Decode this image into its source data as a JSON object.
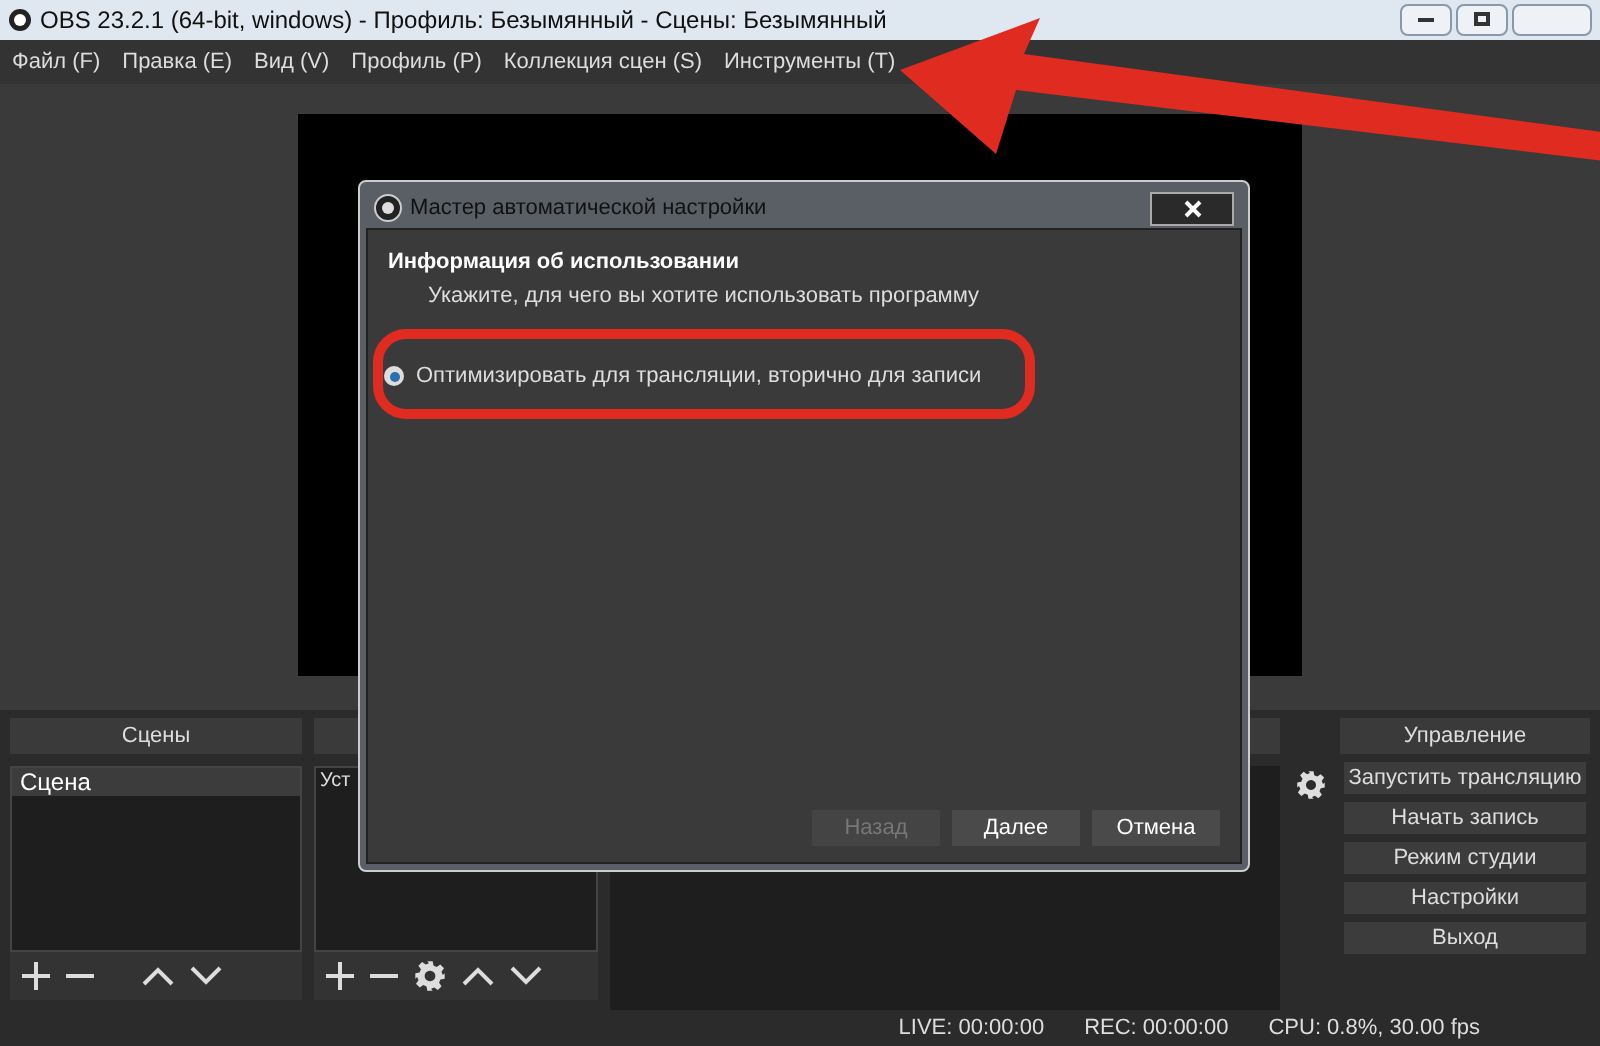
{
  "window": {
    "title": "OBS 23.2.1 (64-bit, windows) - Профиль: Безымянный - Сцены: Безымянный"
  },
  "menu": [
    "Файл (F)",
    "Правка (E)",
    "Вид (V)",
    "Профиль (P)",
    "Коллекция сцен (S)",
    "Инструменты (T)"
  ],
  "scenes_dock": {
    "title": "Сцены",
    "items": [
      {
        "label": "Сцена",
        "selected": true
      }
    ]
  },
  "sources_dock": {
    "items": [
      {
        "label": "Уст",
        "selected": false
      }
    ]
  },
  "controls_dock": {
    "title": "Управление",
    "buttons": [
      "Запустить трансляцию",
      "Начать запись",
      "Режим студии",
      "Настройки",
      "Выход"
    ]
  },
  "status_bar": {
    "live": "LIVE: 00:00:00",
    "rec": "REC: 00:00:00",
    "cpu": "CPU: 0.8%, 30.00 fps"
  },
  "dialog": {
    "title": "Мастер автоматической настройки",
    "heading": "Информация об использовании",
    "subheading": "Укажите, для чего вы хотите использовать программу",
    "options": [
      {
        "label": "Оптимизировать для трансляции, вторично для записи",
        "selected": true
      }
    ],
    "buttons": [
      {
        "label": "Назад",
        "disabled": true
      },
      {
        "label": "Далее",
        "disabled": false
      },
      {
        "label": "Отмена",
        "disabled": false
      }
    ]
  }
}
